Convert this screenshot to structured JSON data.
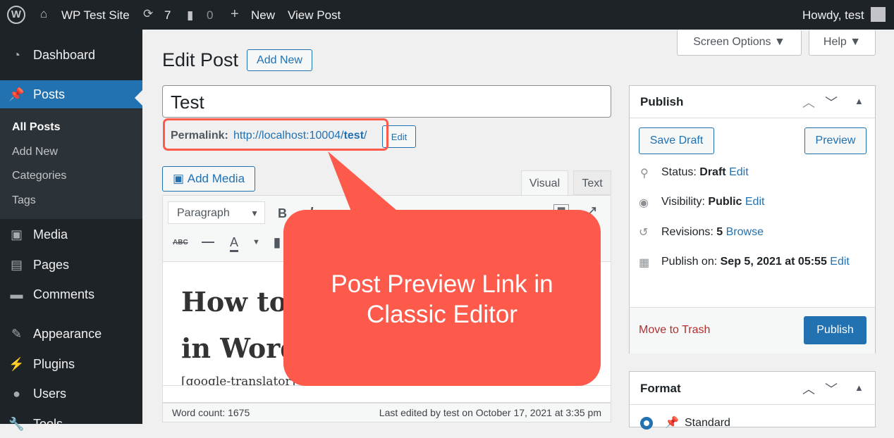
{
  "adminbar": {
    "site": "WP Test Site",
    "updates": "7",
    "comments": "0",
    "new": "New",
    "view_post": "View Post",
    "howdy": "Howdy, test"
  },
  "sidebar": {
    "items": [
      {
        "label": "Dashboard",
        "icon": "dashboard-icon"
      },
      {
        "label": "Posts",
        "icon": "pin-icon"
      },
      {
        "label": "Media",
        "icon": "media-icon"
      },
      {
        "label": "Pages",
        "icon": "pages-icon"
      },
      {
        "label": "Comments",
        "icon": "comment-icon"
      },
      {
        "label": "Appearance",
        "icon": "brush-icon"
      },
      {
        "label": "Plugins",
        "icon": "plugin-icon"
      },
      {
        "label": "Users",
        "icon": "user-icon"
      },
      {
        "label": "Tools",
        "icon": "tools-icon"
      }
    ],
    "submenu": [
      "All Posts",
      "Add New",
      "Categories",
      "Tags"
    ]
  },
  "header": {
    "title": "Edit Post",
    "add_new": "Add New",
    "screen_options": "Screen Options",
    "help": "Help"
  },
  "post": {
    "title": "Test",
    "permalink_label": "Permalink:",
    "permalink_url": "http://localhost:10004/",
    "permalink_slug": "test",
    "permalink_trail": "/",
    "edit": "Edit"
  },
  "editor": {
    "add_media": "Add Media",
    "tab_visual": "Visual",
    "tab_text": "Text",
    "format": "Paragraph",
    "heading_line1": "How to",
    "heading_line2": "in Word",
    "shortcode": "[google-translator]",
    "word_count": "Word count: 1675",
    "last_edited": "Last edited by test on October 17, 2021 at 3:35 pm"
  },
  "callout": {
    "line1": "Post Preview Link in",
    "line2": "Classic Editor",
    "color": "#fd5a4b"
  },
  "publish": {
    "title": "Publish",
    "save_draft": "Save Draft",
    "preview": "Preview",
    "status_label": "Status:",
    "status": "Draft",
    "visibility_label": "Visibility:",
    "visibility": "Public",
    "revisions_label": "Revisions:",
    "revisions": "5",
    "browse": "Browse",
    "publish_on_label": "Publish on:",
    "publish_on": "Sep 5, 2021 at 05:55",
    "edit": "Edit",
    "trash": "Move to Trash",
    "publish_btn": "Publish"
  },
  "format": {
    "title": "Format",
    "option": "Standard"
  }
}
